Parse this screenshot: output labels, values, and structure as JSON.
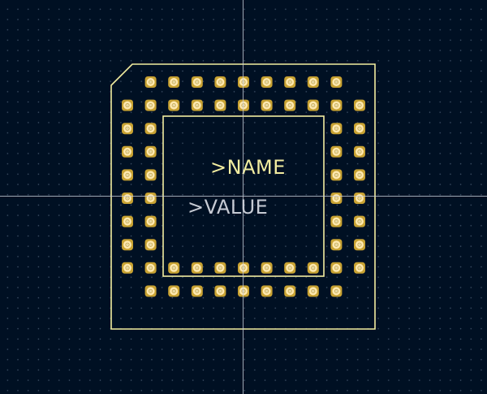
{
  "board": {
    "name_field": ">NAME",
    "value_field": ">VALUE"
  },
  "colors": {
    "background": "#001023",
    "grid_dot": "#6f8099",
    "silkscreen": "#f2eda0",
    "pad_copper": "#c8a232",
    "pad_face": "#ffe9b0",
    "value_text": "#c7cbd4",
    "crosshair": "#c8ccd6"
  },
  "footprint": {
    "rows": 10,
    "cols": 10,
    "outer_ring_rows": 2,
    "hole_color": "#e9d9a4"
  },
  "icons": {
    "pad": "square-pad-icon",
    "crosshair": "crosshair-icon"
  }
}
